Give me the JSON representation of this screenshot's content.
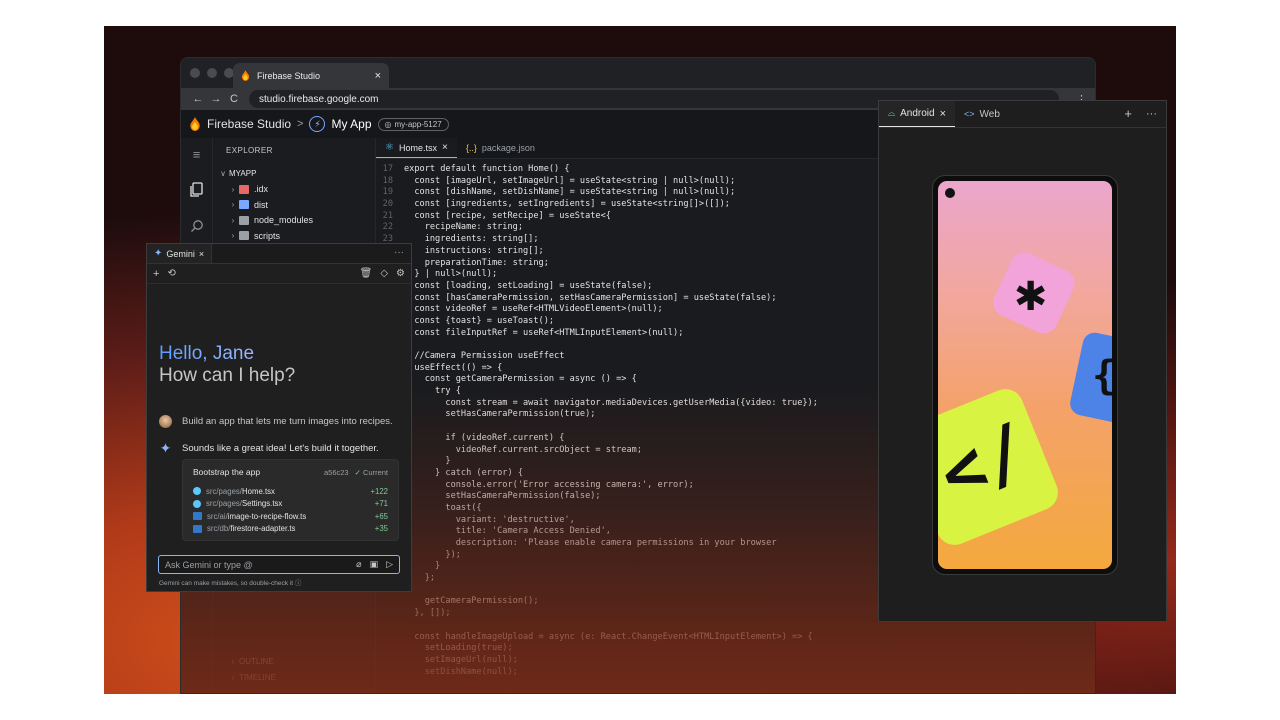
{
  "browser": {
    "tab_title": "Firebase Studio",
    "tab_close": "×",
    "url": "studio.firebase.google.com",
    "nav_back": "←",
    "nav_forward": "→",
    "nav_reload": "C",
    "menu": "⋮"
  },
  "appbar": {
    "brand": "Firebase Studio",
    "separator": ">",
    "app_name": "My App",
    "project_id": "my-app-5127"
  },
  "explorer": {
    "title": "EXPLORER",
    "root": "MYAPP",
    "items": [
      {
        "name": ".idx",
        "color": "#e66868"
      },
      {
        "name": "dist",
        "color": "#7aa7ff"
      },
      {
        "name": "node_modules",
        "color": "#9aa0a6"
      },
      {
        "name": "scripts",
        "color": "#9aa0a6"
      }
    ],
    "bottom": [
      "OUTLINE",
      "TIMELINE"
    ]
  },
  "editor": {
    "tabs": [
      {
        "label": "Home.tsx",
        "icon": "react-icon",
        "active": true
      },
      {
        "label": "package.json",
        "icon": "json-icon",
        "active": false
      }
    ],
    "lines": [
      {
        "n": "17",
        "t": "export default function Home() {"
      },
      {
        "n": "18",
        "t": "  const [imageUrl, setImageUrl] = useState<string | null>(null);"
      },
      {
        "n": "19",
        "t": "  const [dishName, setDishName] = useState<string | null>(null);"
      },
      {
        "n": "20",
        "t": "  const [ingredients, setIngredients] = useState<string[]>([]);"
      },
      {
        "n": "21",
        "t": "  const [recipe, setRecipe] = useState<{"
      },
      {
        "n": "22",
        "t": "    recipeName: string;"
      },
      {
        "n": "23",
        "t": "    ingredients: string[];"
      },
      {
        "n": "",
        "t": "    instructions: string[];"
      },
      {
        "n": "",
        "t": "    preparationTime: string;"
      },
      {
        "n": "",
        "t": "  } | null>(null);"
      },
      {
        "n": "",
        "t": "  const [loading, setLoading] = useState(false);"
      },
      {
        "n": "",
        "t": "  const [hasCameraPermission, setHasCameraPermission] = useState(false);"
      },
      {
        "n": "",
        "t": "  const videoRef = useRef<HTMLVideoElement>(null);"
      },
      {
        "n": "",
        "t": "  const {toast} = useToast();"
      },
      {
        "n": "",
        "t": "  const fileInputRef = useRef<HTMLInputElement>(null);"
      },
      {
        "n": "",
        "t": ""
      },
      {
        "n": "",
        "t": "  //Camera Permission useEffect"
      },
      {
        "n": "",
        "t": "  useEffect(() => {"
      },
      {
        "n": "",
        "t": "    const getCameraPermission = async () => {"
      },
      {
        "n": "",
        "t": "      try {"
      },
      {
        "n": "",
        "t": "        const stream = await navigator.mediaDevices.getUserMedia({video: true});"
      },
      {
        "n": "",
        "t": "        setHasCameraPermission(true);"
      },
      {
        "n": "",
        "t": ""
      },
      {
        "n": "",
        "t": "        if (videoRef.current) {"
      },
      {
        "n": "",
        "t": "          videoRef.current.srcObject = stream;"
      },
      {
        "n": "",
        "t": "        }"
      },
      {
        "n": "",
        "t": "      } catch (error) {"
      },
      {
        "n": "",
        "t": "        console.error('Error accessing camera:', error);"
      },
      {
        "n": "",
        "t": "        setHasCameraPermission(false);"
      },
      {
        "n": "",
        "t": "        toast({"
      },
      {
        "n": "",
        "t": "          variant: 'destructive',"
      },
      {
        "n": "",
        "t": "          title: 'Camera Access Denied',"
      },
      {
        "n": "",
        "t": "          description: 'Please enable camera permissions in your browser"
      },
      {
        "n": "",
        "t": "        });"
      },
      {
        "n": "",
        "t": "      }"
      },
      {
        "n": "",
        "t": "    };"
      },
      {
        "n": "",
        "t": ""
      },
      {
        "n": "",
        "t": "    getCameraPermission();"
      },
      {
        "n": "",
        "t": "  }, []);"
      },
      {
        "n": "",
        "t": ""
      },
      {
        "n": "",
        "t": "  const handleImageUpload = async (e: React.ChangeEvent<HTMLInputElement>) => {"
      },
      {
        "n": "",
        "t": "    setLoading(true);"
      },
      {
        "n": "",
        "t": "    setImageUrl(null);"
      },
      {
        "n": "",
        "t": "    setDishName(null);"
      }
    ]
  },
  "gemini": {
    "tab_label": "Gemini",
    "greeting_line1": "Hello, Jane",
    "greeting_line2": "How can I help?",
    "user_message": "Build an app that lets me turn images into recipes.",
    "ai_message": "Sounds like a great idea! Let's build it together.",
    "card": {
      "title": "Bootstrap the app",
      "hash": "a56c23",
      "status": "Current",
      "files": [
        {
          "dir": "src/pages/",
          "name": "Home.tsx",
          "added": "+122",
          "icon": "react-file-icon"
        },
        {
          "dir": "src/pages/",
          "name": "Settings.tsx",
          "added": "+71",
          "icon": "react-file-icon"
        },
        {
          "dir": "src/ai/",
          "name": "image-to-recipe-flow.ts",
          "added": "+65",
          "icon": "ts-file-icon"
        },
        {
          "dir": "src/db/",
          "name": "firestore-adapter.ts",
          "added": "+35",
          "icon": "ts-file-icon"
        }
      ]
    },
    "input_placeholder": "Ask Gemini or type @",
    "disclaimer": "Gemini can make mistakes, so double-check it"
  },
  "preview": {
    "tabs": [
      {
        "label": "Android",
        "active": true
      },
      {
        "label": "Web",
        "active": false
      }
    ]
  }
}
